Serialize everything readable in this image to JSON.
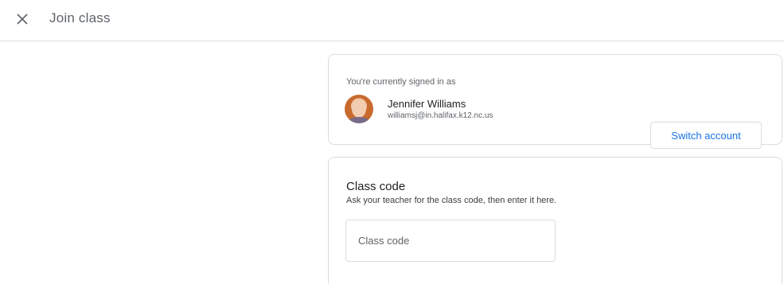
{
  "header": {
    "close_icon": "close-icon",
    "title": "Join class"
  },
  "account": {
    "label": "You're currently signed in as",
    "name": "Jennifer Williams",
    "email": "williamsj@in.halifax.k12.nc.us",
    "switch_label": "Switch account"
  },
  "class_code": {
    "heading": "Class code",
    "help": "Ask your teacher for the class code, then enter it here.",
    "input_value": "",
    "placeholder": "Class code"
  },
  "colors": {
    "accent": "#1a73e8",
    "border": "#dadce0"
  }
}
